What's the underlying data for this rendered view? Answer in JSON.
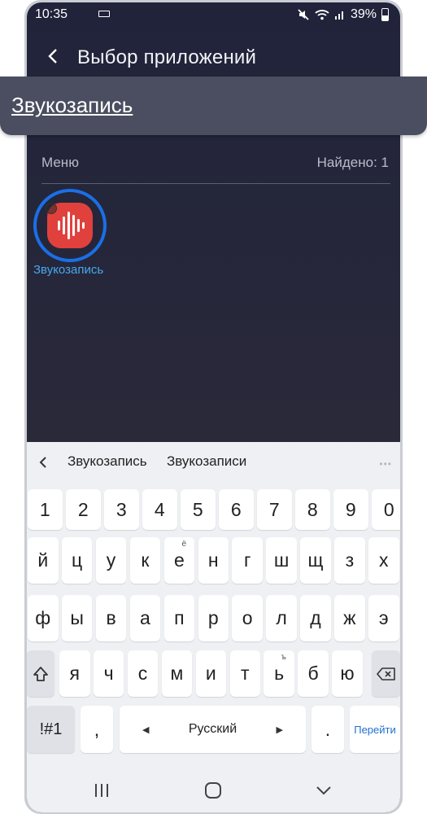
{
  "status": {
    "time": "10:35",
    "battery": "39%",
    "battery_level": 0.39
  },
  "header": {
    "title": "Выбор приложений"
  },
  "tooltip": {
    "text": "Звукозапись"
  },
  "section": {
    "left": "Меню",
    "right": "Найдено: 1"
  },
  "results": [
    {
      "label": "Звукозапись",
      "icon": "voice-recorder-icon",
      "color": "#e0413d"
    }
  ],
  "focus_color": "#1a6fe6",
  "keyboard": {
    "suggestions": [
      "Звукозапись",
      "Звукозаписи"
    ],
    "number_row": [
      "1",
      "2",
      "3",
      "4",
      "5",
      "6",
      "7",
      "8",
      "9",
      "0"
    ],
    "row1": [
      "й",
      "ц",
      "у",
      "к",
      "е",
      "н",
      "г",
      "ш",
      "щ",
      "з",
      "х"
    ],
    "row1_sup": {
      "е": "ё"
    },
    "row2": [
      "ф",
      "ы",
      "в",
      "а",
      "п",
      "р",
      "о",
      "л",
      "д",
      "ж",
      "э"
    ],
    "row3": [
      "я",
      "ч",
      "с",
      "м",
      "и",
      "т",
      "ь",
      "б",
      "ю"
    ],
    "row3_sup": {
      "ь": "ъ"
    },
    "symbols_label": "!#1",
    "comma": ",",
    "space_label": "Русский",
    "period": ".",
    "go_label": "Перейти"
  }
}
